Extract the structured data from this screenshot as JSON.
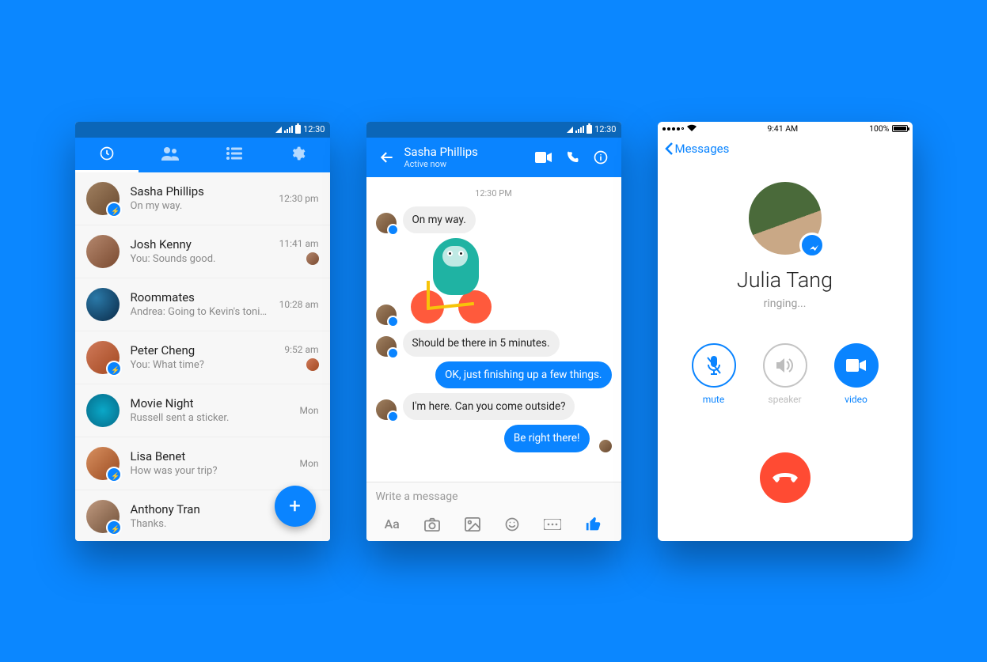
{
  "android_status": {
    "time": "12:30"
  },
  "screen1": {
    "tabs": [
      "recents",
      "people",
      "groups",
      "settings"
    ],
    "conversations": [
      {
        "name": "Sasha Phillips",
        "preview": "On my way.",
        "time": "12:30 pm",
        "avatar_class": "c1",
        "messenger_badge": true,
        "seen_avatar": null
      },
      {
        "name": "Josh Kenny",
        "preview": "You: Sounds good.",
        "time": "11:41 am",
        "avatar_class": "c2",
        "messenger_badge": false,
        "seen_avatar": "c2"
      },
      {
        "name": "Roommates",
        "preview": "Andrea: Going to Kevin's tonight?",
        "time": "10:28 am",
        "avatar_class": "c3",
        "messenger_badge": false,
        "seen_avatar": null
      },
      {
        "name": "Peter Cheng",
        "preview": "You: What time?",
        "time": "9:52 am",
        "avatar_class": "c4",
        "messenger_badge": true,
        "seen_avatar": "c4"
      },
      {
        "name": "Movie Night",
        "preview": "Russell sent a sticker.",
        "time": "Mon",
        "avatar_class": "c5",
        "messenger_badge": false,
        "seen_avatar": null
      },
      {
        "name": "Lisa Benet",
        "preview": "How was your trip?",
        "time": "Mon",
        "avatar_class": "c6",
        "messenger_badge": true,
        "seen_avatar": null
      },
      {
        "name": "Anthony Tran",
        "preview": "Thanks.",
        "time": "",
        "avatar_class": "c7",
        "messenger_badge": true,
        "seen_avatar": null
      }
    ],
    "fab": "+"
  },
  "screen2": {
    "name": "Sasha Phillips",
    "status": "Active now",
    "timestamp": "12:30 PM",
    "messages": [
      {
        "side": "them",
        "text": "On my way.",
        "avatar": true
      },
      {
        "side": "them",
        "sticker": true,
        "avatar": true
      },
      {
        "side": "them",
        "text": "Should be there in 5 minutes.",
        "avatar": true
      },
      {
        "side": "me",
        "text": "OK, just finishing up a few things."
      },
      {
        "side": "them",
        "text": "I'm here. Can you come outside?",
        "avatar": true
      },
      {
        "side": "me",
        "text": "Be right there!",
        "seen": true
      }
    ],
    "placeholder": "Write a message"
  },
  "screen3": {
    "ios_status": {
      "time": "9:41 AM",
      "battery": "100%"
    },
    "back": "Messages",
    "name": "Julia Tang",
    "status": "ringing...",
    "actions": {
      "mute": "mute",
      "speaker": "speaker",
      "video": "video"
    }
  }
}
